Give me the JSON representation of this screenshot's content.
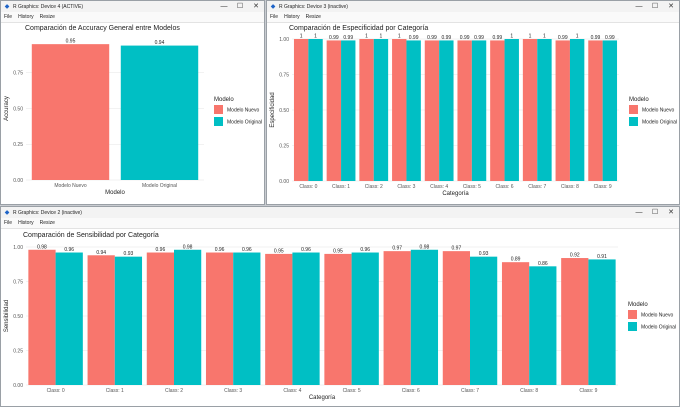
{
  "legend_title": "Modelo",
  "menu": [
    "File",
    "History",
    "Resize"
  ],
  "window_buttons": {
    "minimize": "—",
    "maximize": "☐",
    "close": "✕"
  },
  "windows": [
    {
      "id": "w4",
      "title": "R Graphics: Device 4 (ACTIVE)",
      "chart_data": {
        "type": "bar",
        "title": "Comparación de Accuracy General entre Modelos",
        "xlabel": "Modelo",
        "ylabel": "Accuracy",
        "categories": [
          "Modelo Nuevo",
          "Modelo Original"
        ],
        "series": [
          {
            "name": "Modelo Nuevo"
          },
          {
            "name": "Modelo Original"
          }
        ],
        "values": [
          0.95,
          0.94
        ],
        "labels": [
          "0.95",
          "0.94"
        ],
        "ylim": [
          0,
          1
        ],
        "yticks": [
          "0.00",
          "0.25",
          "0.50",
          "0.75"
        ],
        "colors": [
          "#F8766D",
          "#00BFC4"
        ],
        "legend": "right"
      }
    },
    {
      "id": "w3",
      "title": "R Graphics: Device 3 (inactive)",
      "chart_data": {
        "type": "bar",
        "title": "Comparación de Especificidad por Categoría",
        "xlabel": "Categoría",
        "ylabel": "Especificidad",
        "categories": [
          "Class: 0",
          "Class: 1",
          "Class: 2",
          "Class: 3",
          "Class: 4",
          "Class: 5",
          "Class: 6",
          "Class: 7",
          "Class: 8",
          "Class: 9"
        ],
        "series": [
          {
            "name": "Modelo Nuevo",
            "values": [
              1.0,
              0.99,
              1.0,
              1.0,
              0.99,
              0.99,
              0.99,
              1.0,
              0.99,
              0.99
            ],
            "labels": [
              "1",
              "0.99",
              "1",
              "1",
              "0.99",
              "0.99",
              "0.99",
              "1",
              "0.99",
              "0.99"
            ]
          },
          {
            "name": "Modelo Original",
            "values": [
              1.0,
              0.99,
              1.0,
              0.99,
              0.99,
              0.99,
              1.0,
              1.0,
              1.0,
              0.99
            ],
            "labels": [
              "1",
              "0.99",
              "1",
              "0.99",
              "0.99",
              "0.99",
              "1",
              "1",
              "1",
              "0.99"
            ]
          }
        ],
        "ylim": [
          0,
          1
        ],
        "yticks": [
          "0.00",
          "0.25",
          "0.50",
          "0.75",
          "1.00"
        ],
        "colors": [
          "#F8766D",
          "#00BFC4"
        ],
        "legend": "right"
      }
    },
    {
      "id": "w2",
      "title": "R Graphics: Device 2 (inactive)",
      "chart_data": {
        "type": "bar",
        "title": "Comparación de Sensibilidad por Categoría",
        "xlabel": "Categoría",
        "ylabel": "Sensibilidad",
        "categories": [
          "Class: 0",
          "Class: 1",
          "Class: 2",
          "Class: 3",
          "Class: 4",
          "Class: 5",
          "Class: 6",
          "Class: 7",
          "Class: 8",
          "Class: 9"
        ],
        "series": [
          {
            "name": "Modelo Nuevo",
            "values": [
              0.98,
              0.94,
              0.96,
              0.96,
              0.95,
              0.95,
              0.97,
              0.97,
              0.89,
              0.92
            ],
            "labels": [
              "0.98",
              "0.94",
              "0.96",
              "0.96",
              "0.95",
              "0.95",
              "0.97",
              "0.97",
              "0.89",
              "0.92"
            ]
          },
          {
            "name": "Modelo Original",
            "values": [
              0.96,
              0.93,
              0.98,
              0.96,
              0.96,
              0.96,
              0.98,
              0.93,
              0.86,
              0.91
            ],
            "labels": [
              "0.96",
              "0.93",
              "0.98",
              "0.96",
              "0.96",
              "0.96",
              "0.98",
              "0.93",
              "0.86",
              "0.91"
            ]
          }
        ],
        "ylim": [
          0,
          1
        ],
        "yticks": [
          "0.00",
          "0.25",
          "0.50",
          "0.75",
          "1.00"
        ],
        "colors": [
          "#F8766D",
          "#00BFC4"
        ],
        "legend": "right"
      }
    }
  ]
}
